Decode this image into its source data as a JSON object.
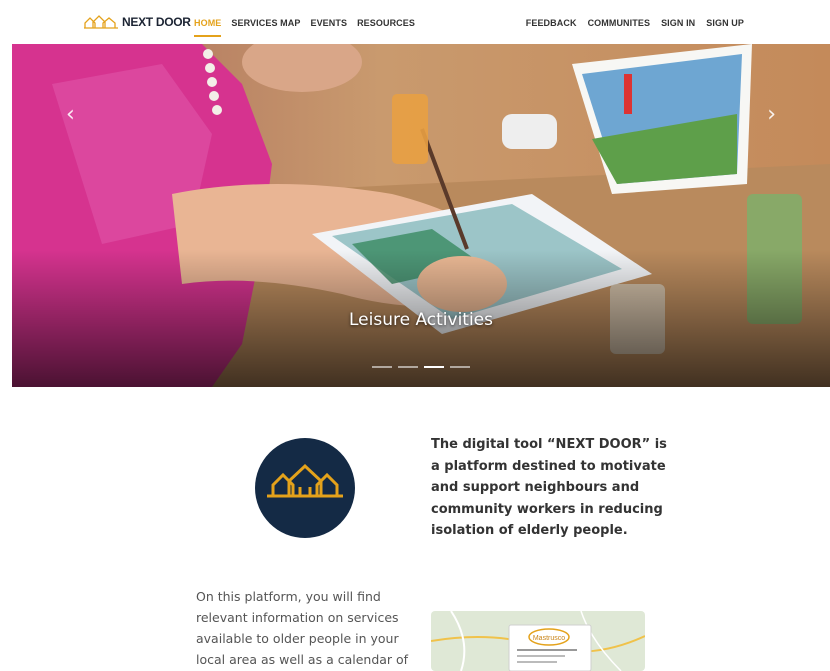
{
  "brand": {
    "name": "NEXT DOOR"
  },
  "nav": {
    "left": [
      {
        "label": "HOME",
        "active": true
      },
      {
        "label": "SERVICES MAP"
      },
      {
        "label": "EVENTS"
      },
      {
        "label": "RESOURCES"
      }
    ],
    "right": [
      {
        "label": "FEEDBACK"
      },
      {
        "label": "COMMUNITES"
      },
      {
        "label": "SIGN IN"
      },
      {
        "label": "SIGN UP"
      }
    ]
  },
  "hero": {
    "caption": "Leisure Activities",
    "prev_icon": "chevron-left-icon",
    "next_icon": "chevron-right-icon",
    "slide_count": 4,
    "active_slide": 3
  },
  "intro": {
    "text": "The digital tool “NEXT DOOR” is a platform destined to motivate and support neighbours and community workers in reducing isolation of elderly people."
  },
  "body": {
    "text": "On this platform, you will find relevant information on services available to older people in your local area as well as a calendar of"
  },
  "map_preview": {
    "label": "Mastrusco"
  },
  "colors": {
    "accent": "#e4a21b",
    "navy": "#142a45"
  }
}
